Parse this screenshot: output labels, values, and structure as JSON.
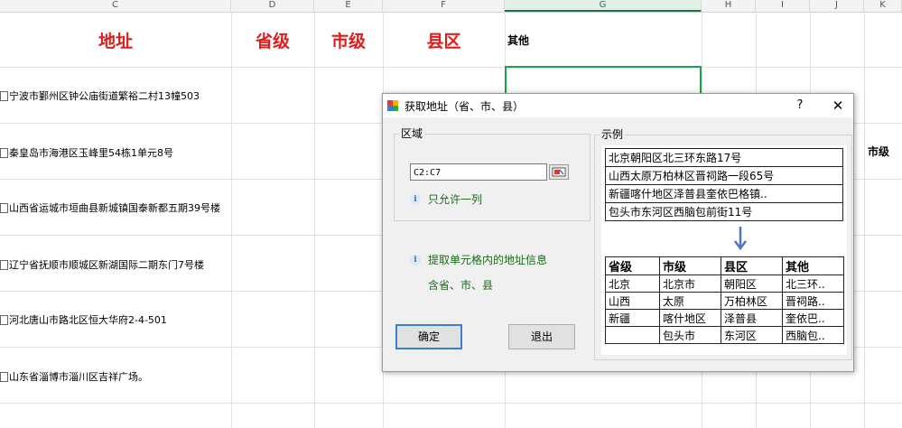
{
  "sheet": {
    "columns": [
      "C",
      "D",
      "E",
      "F",
      "G",
      "H",
      "I",
      "J",
      "K"
    ],
    "active_column": "G",
    "headers": {
      "address": "地址",
      "province": "省级",
      "city": "市级",
      "county": "县区",
      "other": "其他"
    },
    "rows": [
      "宁波市鄞州区钟公庙街道繁裕二村13幢503",
      "秦皇岛市海港区玉峰里54栋1单元8号",
      "山西省运城市垣曲县新城镇国泰新都五期39号楼",
      "辽宁省抚顺市顺城区新湖国际二期东门7号楼",
      "河北唐山市路北区恒大华府2-4-501",
      "山东省淄博市淄川区吉祥广场。"
    ],
    "partial_header": "市级"
  },
  "dialog": {
    "title": "获取地址（省、市、县）",
    "help_label": "?",
    "close_label": "✕",
    "region_group_label": "区域",
    "range_value": "C2:C7",
    "only_one_column_note": "只允许一列",
    "extract_note_line1": "提取单元格内的地址信息",
    "extract_note_line2": "含省、市、县",
    "ok_label": "确定",
    "exit_label": "退出",
    "example_group_label": "示例",
    "example_addresses": [
      "北京朝阳区北三环东路17号",
      "山西太原万柏林区晋祠路一段65号",
      "新疆喀什地区泽普县奎依巴格镇..",
      "包头市东河区西脑包前街11号"
    ],
    "example_table": {
      "headers": [
        "省级",
        "市级",
        "县区",
        "其他"
      ],
      "rows": [
        [
          "北京",
          "北京市",
          "朝阳区",
          "北三环.."
        ],
        [
          "山西",
          "太原",
          "万柏林区",
          "晋祠路.."
        ],
        [
          "新疆",
          "喀什地区",
          "泽普县",
          "奎依巴.."
        ],
        [
          "",
          "包头市",
          "东河区",
          "西脑包.."
        ]
      ]
    }
  },
  "colors": {
    "header_red": "#e21b1b",
    "note_green": "#1a6a1a",
    "selection_green": "#19a34a",
    "arrow_blue": "#4a78c4"
  }
}
